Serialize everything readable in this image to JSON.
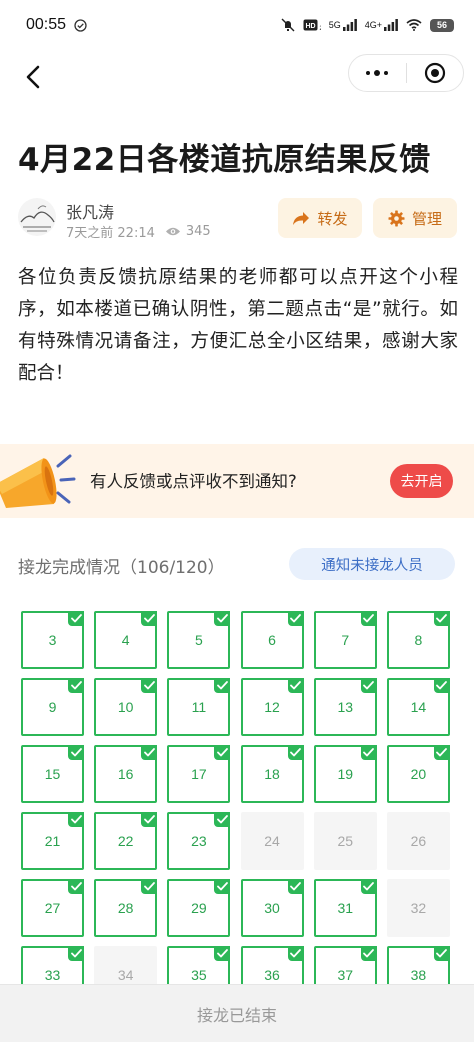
{
  "status_bar": {
    "time": "00:55",
    "network_labels": [
      "5G",
      "4G+"
    ],
    "battery": "56",
    "icons": [
      "check-circle-icon",
      "mute-icon",
      "hd-icon",
      "signal-icon",
      "wifi-icon",
      "battery-icon"
    ]
  },
  "nav": {
    "back_icon": "chevron-left-icon",
    "more_icon": "more-dots-icon",
    "close_icon": "target-close-icon"
  },
  "article": {
    "title": "4月22日各楼道抗原结果反馈",
    "author": "张凡涛",
    "time": "7天之前 22:14",
    "views": "345",
    "forward_label": "转发",
    "manage_label": "管理",
    "content": "各位负责反馈抗原结果的老师都可以点开这个小程序，如本楼道已确认阴性，第二题点击“是”就行。如有特殊情况请备注，方便汇总全小区结果，感谢大家配合！"
  },
  "banner": {
    "text": "有人反馈或点评收不到通知?",
    "button_label": "去开启",
    "icon": "megaphone-icon"
  },
  "progress": {
    "label": "接龙完成情况（106/120）",
    "notify_label": "通知未接龙人员"
  },
  "grid": [
    {
      "label": "3",
      "done": true
    },
    {
      "label": "4",
      "done": true
    },
    {
      "label": "5",
      "done": true
    },
    {
      "label": "6",
      "done": true
    },
    {
      "label": "7",
      "done": true
    },
    {
      "label": "8",
      "done": true
    },
    {
      "label": "9",
      "done": true
    },
    {
      "label": "10",
      "done": true
    },
    {
      "label": "11",
      "done": true
    },
    {
      "label": "12",
      "done": true
    },
    {
      "label": "13",
      "done": true
    },
    {
      "label": "14",
      "done": true
    },
    {
      "label": "15",
      "done": true
    },
    {
      "label": "16",
      "done": true
    },
    {
      "label": "17",
      "done": true
    },
    {
      "label": "18",
      "done": true
    },
    {
      "label": "19",
      "done": true
    },
    {
      "label": "20",
      "done": true
    },
    {
      "label": "21",
      "done": true
    },
    {
      "label": "22",
      "done": true
    },
    {
      "label": "23",
      "done": true
    },
    {
      "label": "24",
      "done": false
    },
    {
      "label": "25",
      "done": false
    },
    {
      "label": "26",
      "done": false
    },
    {
      "label": "27",
      "done": true
    },
    {
      "label": "28",
      "done": true
    },
    {
      "label": "29",
      "done": true
    },
    {
      "label": "30",
      "done": true
    },
    {
      "label": "31",
      "done": true
    },
    {
      "label": "32",
      "done": false
    },
    {
      "label": "33",
      "done": true
    },
    {
      "label": "34",
      "done": false
    },
    {
      "label": "35",
      "done": true
    },
    {
      "label": "36",
      "done": true
    },
    {
      "label": "37",
      "done": true
    },
    {
      "label": "38",
      "done": true
    }
  ],
  "bottom": {
    "label": "接龙已结束"
  },
  "colors": {
    "accent_green": "#2cb757",
    "accent_orange": "#c66b16",
    "badge_red": "#ee4b49",
    "notify_blue": "#3e6fc6"
  }
}
